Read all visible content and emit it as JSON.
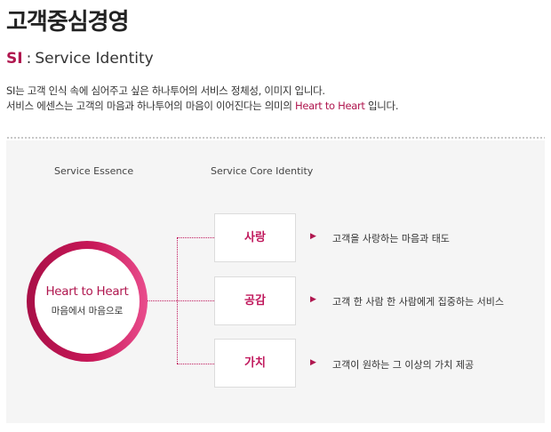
{
  "page": {
    "title": "고객중심경영",
    "subtitle_prefix": "SI",
    "subtitle_colon": ":",
    "subtitle_text": "Service Identity",
    "intro_line1": "SI는 고객 인식 속에 심어주고 싶은 하나투어의 서비스 정체성, 이미지 입니다.",
    "intro_line2_pre": "서비스 에센스는 고객의 마음과 하나투어의 마음이 이어진다는 의미의 ",
    "intro_line2_highlight": "Heart to Heart",
    "intro_line2_post": " 입니다."
  },
  "diagram": {
    "essence_label": "Service Essence",
    "core_label": "Service Core Identity",
    "essence_title": "Heart to Heart",
    "essence_subtitle": "마음에서 마음으로",
    "items": [
      {
        "name": "사랑",
        "desc": "고객을 사랑하는 마음과 태도"
      },
      {
        "name": "공감",
        "desc": "고객 한 사람 한 사람에게 집중하는 서비스"
      },
      {
        "name": "가치",
        "desc": "고객이 원하는 그 이상의 가치 제공"
      }
    ],
    "arrow_glyph": "▶"
  },
  "colors": {
    "accent": "#b0174f",
    "ring_start": "#a90f47",
    "ring_end": "#e94d8d",
    "panel_bg": "#f5f5f5"
  }
}
